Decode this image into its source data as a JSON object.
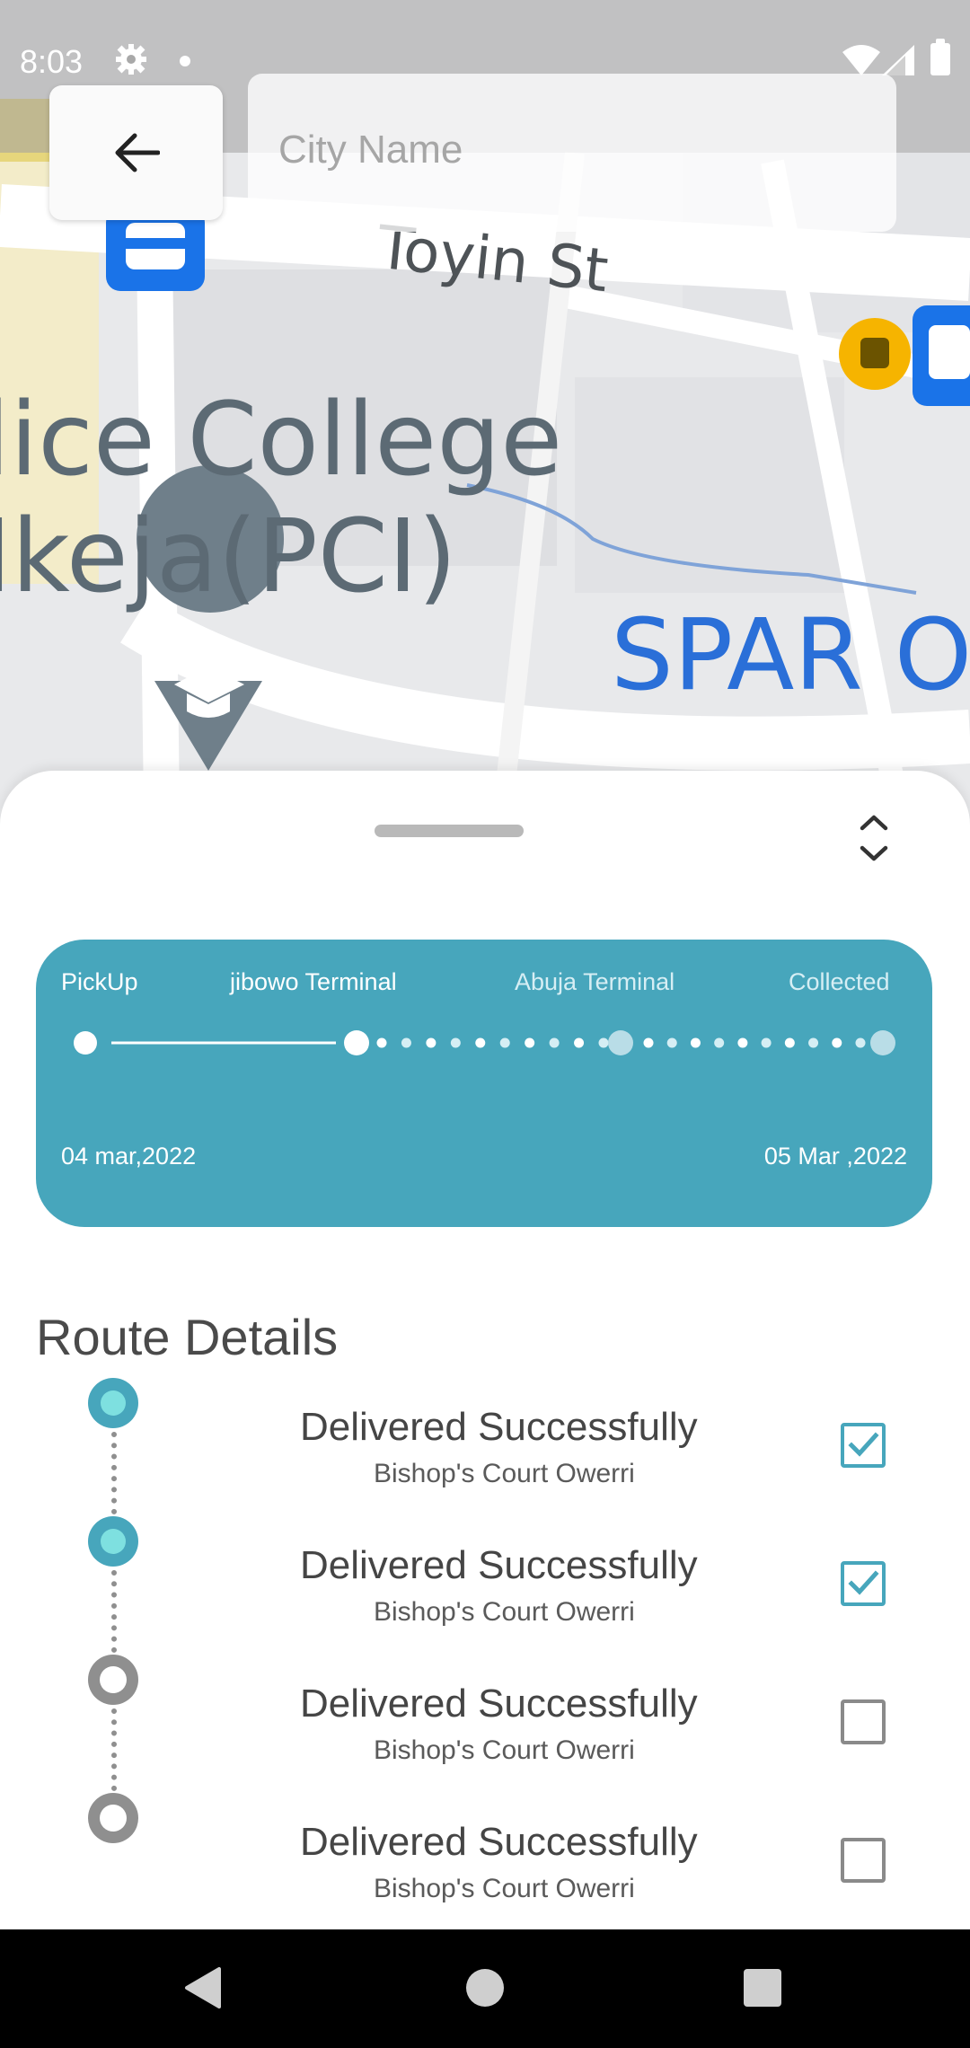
{
  "status_bar": {
    "time": "8:03"
  },
  "map": {
    "street_label": "Toyin St",
    "poi_label_line1": "lice College",
    "poi_label_line2": "Ikeja(PCI)",
    "store_label": "SPAR O"
  },
  "search": {
    "placeholder": "City Name",
    "value": ""
  },
  "tracking": {
    "stages": [
      "PickUp",
      "jibowo Terminal",
      "Abuja Terminal",
      "Collected"
    ],
    "current_stage_index": 1,
    "start_date": "04 mar,2022",
    "end_date": "05 Mar ,2022"
  },
  "route_details": {
    "title": "Route Details",
    "items": [
      {
        "title": "Delivered Successfully",
        "subtitle": "Bishop's Court Owerri",
        "checked": true
      },
      {
        "title": "Delivered Successfully",
        "subtitle": "Bishop's Court Owerri",
        "checked": true
      },
      {
        "title": "Delivered Successfully",
        "subtitle": "Bishop's Court Owerri",
        "checked": false
      },
      {
        "title": "Delivered Successfully",
        "subtitle": "Bishop's Court Owerri",
        "checked": false
      }
    ]
  },
  "colors": {
    "accent": "#47a6bc",
    "accent_light": "#7ee0e0",
    "map_background": "#e8e9eb",
    "bus_stop_blue": "#1a73e8",
    "poi_grey": "#6f7f8a",
    "transit_yellow": "#f6b400"
  },
  "icons": {
    "back": "arrow-left-icon",
    "expand": "unfold-icon",
    "checkbox_checked": "check-icon"
  }
}
